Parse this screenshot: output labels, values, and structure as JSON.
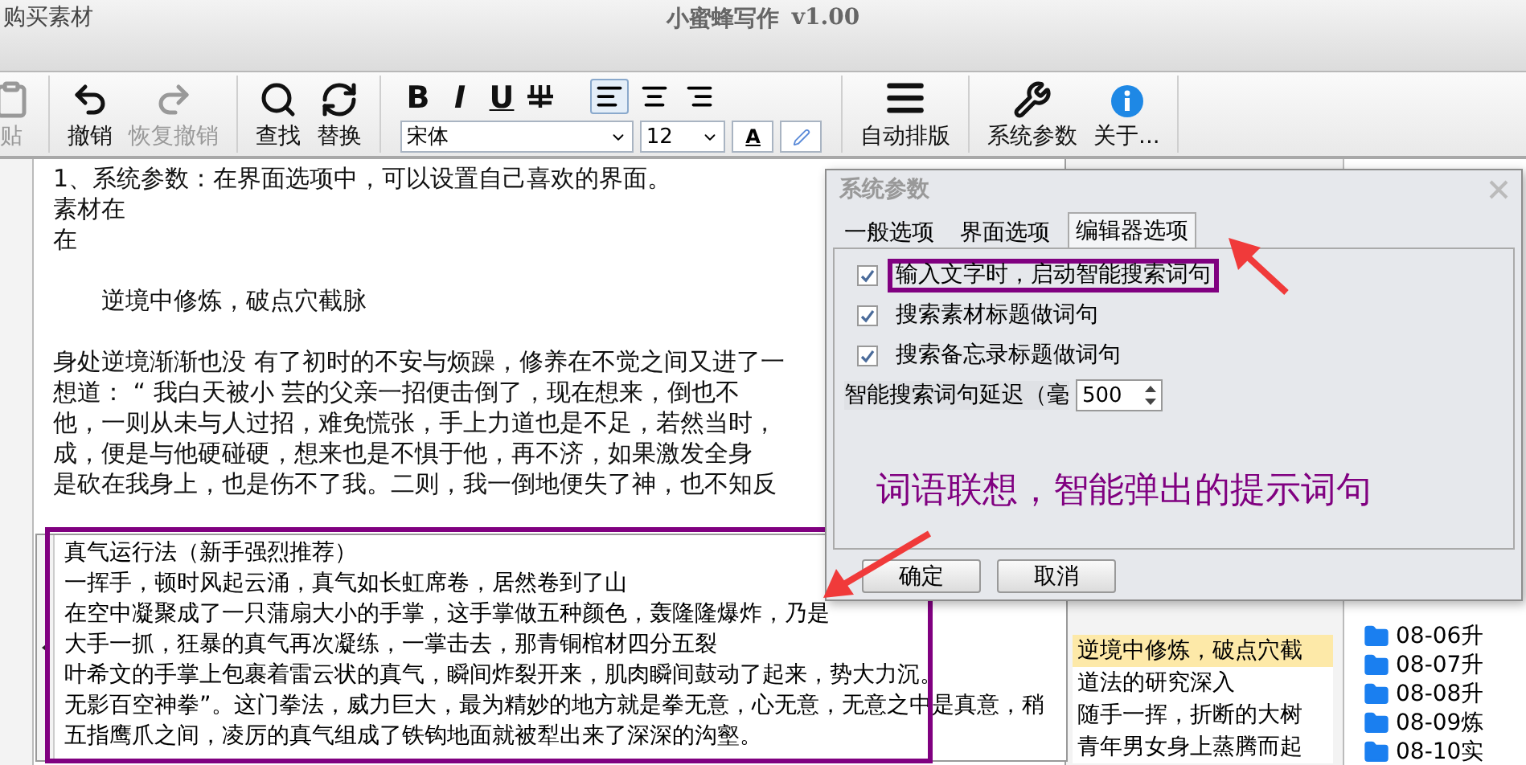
{
  "window": {
    "link": "购买素材",
    "title": "小蜜蜂写作",
    "version": "v1.00"
  },
  "toolbar": {
    "left_buttons": [
      {
        "label": "贴",
        "disabled": true
      },
      {
        "label": "撤销",
        "disabled": false
      },
      {
        "label": "恢复撤销",
        "disabled": true
      },
      {
        "label": "查找",
        "disabled": false
      },
      {
        "label": "替换",
        "disabled": false
      }
    ],
    "format_buttons": [
      "B",
      "I",
      "U"
    ],
    "align": [
      {
        "selected": true
      },
      {
        "selected": false
      },
      {
        "selected": false
      }
    ],
    "font": "宋体",
    "size": "12",
    "color_label": "A",
    "right_buttons": [
      {
        "label": "自动排版"
      },
      {
        "label": "系统参数"
      },
      {
        "label": "关于..."
      }
    ]
  },
  "editor": {
    "lines": [
      {
        "kind": "line",
        "text": "1、系统参数：在界面选项中，可以设置自己喜欢的界面。"
      },
      {
        "kind": "line",
        "text": "素材在"
      },
      {
        "kind": "line",
        "text": "在"
      },
      {
        "kind": "title",
        "text": "逆境中修炼，破点穴截脉"
      },
      {
        "kind": "line",
        "text": "身处逆境渐渐也没 有了初时的不安与烦躁，修养在不觉之间又进了一"
      },
      {
        "kind": "line",
        "text": "想道：  “ 我白天被小 芸的父亲一招便击倒了，现在想来，倒也不"
      },
      {
        "kind": "line",
        "text": "他，一则从未与人过招，难免慌张，手上力道也是不足，若然当时，"
      },
      {
        "kind": "line",
        "text": "成，便是与他硬碰硬，想来也是不惧于他，再不济，如果激发全身"
      },
      {
        "kind": "line",
        "text": "是砍在我身上，也是伤不了我。二则，我一倒地便失了神，也不知反"
      }
    ]
  },
  "suggestions": [
    {
      "text": "真气运行法（新手强烈推荐）"
    },
    {
      "text": "一挥手，顿时风起云涌，真气如长虹席卷，居然卷到了山"
    },
    {
      "text": "在空中凝聚成了一只蒲扇大小的手掌，这手掌做五种颜色，轰隆隆爆炸，乃是"
    },
    {
      "text": "大手一抓，狂暴的真气再次凝练，一掌击去，那青铜棺材四分五裂"
    },
    {
      "text": "叶希文的手掌上包裹着雷云状的真气，瞬间炸裂开来，肌肉瞬间鼓动了起来，势大力沉。"
    },
    {
      "text": "无影百空神拳”。这门拳法，威力巨大，最为精妙的地方就是拳无意，心无意，无意之中是真意，稍"
    },
    {
      "text": "五指鹰爪之间，凌厉的真气组成了铁钩地面就被犁出来了深深的沟壑。"
    }
  ],
  "outline_list": [
    {
      "text": "逆境中修炼，破点穴截",
      "selected": true
    },
    {
      "text": "道法的研究深入",
      "selected": false
    },
    {
      "text": "随手一挥，折断的大树",
      "selected": false
    },
    {
      "text": "青年男女身上蒸腾而起",
      "selected": false
    }
  ],
  "tree": [
    {
      "label": "08-06升"
    },
    {
      "label": "08-07升"
    },
    {
      "label": "08-08升"
    },
    {
      "label": "08-09炼"
    },
    {
      "label": "08-10实"
    }
  ],
  "dialog": {
    "title": "系统参数",
    "tabs": [
      {
        "label": "一般选项",
        "selected": false
      },
      {
        "label": "界面选项",
        "selected": false
      },
      {
        "label": "编辑器选项",
        "selected": true
      }
    ],
    "options": [
      {
        "label": "输入文字时，启动智能搜索词句",
        "checked": true
      },
      {
        "label": "搜索素材标题做词句",
        "checked": true
      },
      {
        "label": "搜索备忘录标题做词句",
        "checked": true
      }
    ],
    "delay_label": "智能搜索词句延迟（毫",
    "delay_value": "500",
    "buttons": [
      "确定",
      "取消"
    ]
  },
  "annotation": "词语联想，智能弹出的提示词句"
}
